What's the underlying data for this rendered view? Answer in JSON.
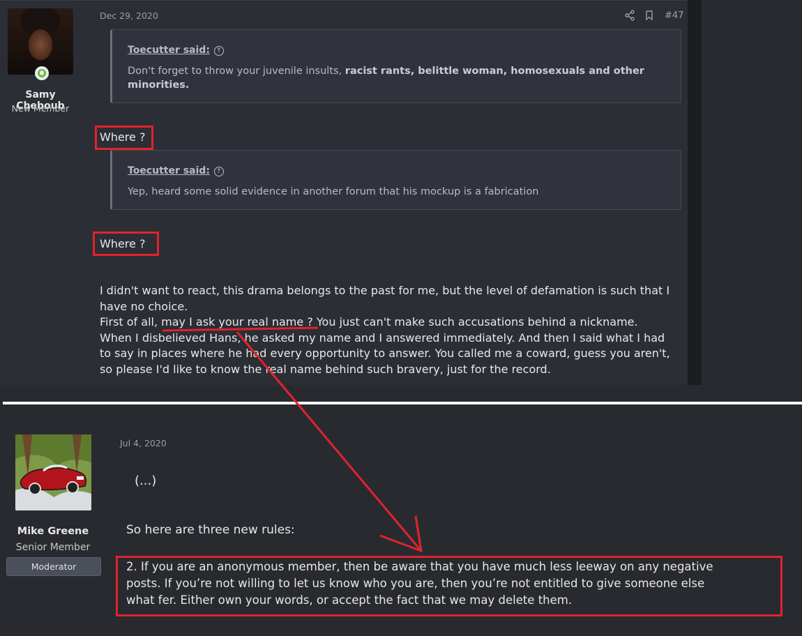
{
  "post1": {
    "date": "Dec 29, 2020",
    "post_number": "#47",
    "author": {
      "name": "Samy Cheboub",
      "title": "New Member"
    },
    "quote1": {
      "author": "Toecutter said:",
      "text_plain": "Don't forget to throw your juvenile insults, ",
      "text_bold": "racist rants, belittle woman, homosexuals and other minorities."
    },
    "reply1": "Where ?",
    "quote2": {
      "author": "Toecutter said:",
      "text": "Yep, heard some solid evidence in another forum that his mockup is a fabrication"
    },
    "reply2": "Where ?",
    "body": {
      "line1": "I didn't want to react, this drama belongs to the past for me, but the level of defamation is such that I",
      "line2": "have no choice.",
      "line3_pre": "First of all, ",
      "line3_underlined": "may I ask your real name ?",
      "line3_post": " You just can't make such accusations behind a nickname.",
      "line4": "When I disbelieved Hans, he asked my name and I answered immediately. And then I said what I had",
      "line5": "to say in places where he had every opportunity to answer. You called me a coward, guess you aren't,",
      "line6": "so please I'd like to know the real name behind such bravery, just for the record."
    }
  },
  "post2": {
    "date": "Jul 4, 2020",
    "author": {
      "name": "Mike Greene",
      "title": "Senior Member",
      "badge": "Moderator"
    },
    "ellipsis": "(...)",
    "intro": "So here are three new rules:",
    "rule": {
      "line1": "2. If you are an anonymous member, then be aware that you have much less leeway on any negative",
      "line2": "posts. If you’re not willing to let us know who you are, then you’re not entitled to give someone else",
      "line3": "what fer. Either own your words, or accept the fact that we may delete them."
    }
  },
  "icons": {
    "share": "share-icon",
    "bookmark": "bookmark-icon",
    "quote_jump": "arrow-up-circle-icon",
    "online": "online-status-icon"
  },
  "colors": {
    "annotation_red": "#e3222c",
    "background": "#282a30",
    "separator": "#ffffff"
  }
}
